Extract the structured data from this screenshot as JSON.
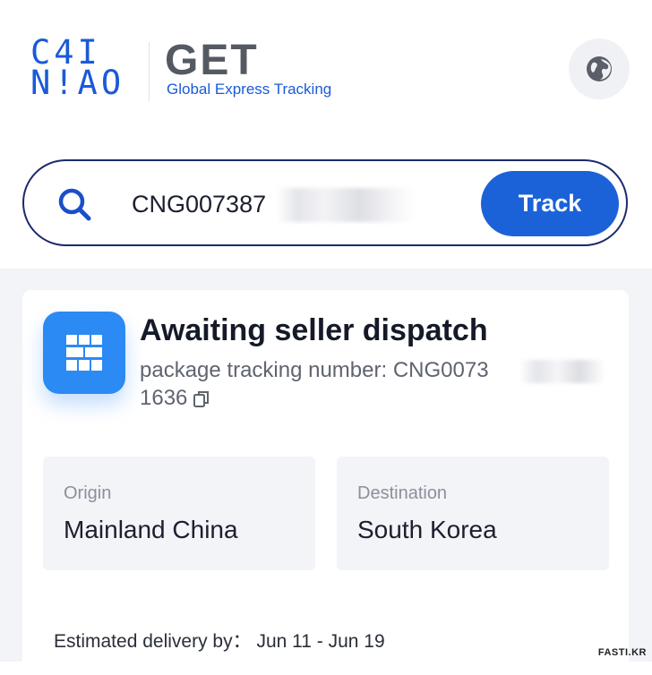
{
  "header": {
    "logo_line1": "C4I",
    "logo_line2": "N!AO",
    "brand": "GET",
    "subtitle": "Global Express Tracking"
  },
  "search": {
    "value": "CNG007387",
    "button_label": "Track"
  },
  "shipment": {
    "status": "Awaiting seller dispatch",
    "tracking_label": "package tracking number: CNG0073",
    "tracking_tail": "1636",
    "origin_label": "Origin",
    "origin_value": "Mainland China",
    "destination_label": "Destination",
    "destination_value": "South Korea",
    "eta_label": "Estimated delivery by：",
    "eta_value": "Jun 11 - Jun 19"
  },
  "watermark": "FASTI.KR",
  "colors": {
    "brand_blue": "#1a5ad8",
    "button_blue": "#1b62d9",
    "status_icon_blue": "#2b8af3",
    "search_border": "#1b2a6b",
    "page_bg": "#f3f4f8"
  },
  "icons": {
    "language": "globe-icon",
    "search": "search-icon",
    "status": "warehouse-grid-icon",
    "copy": "copy-icon"
  }
}
